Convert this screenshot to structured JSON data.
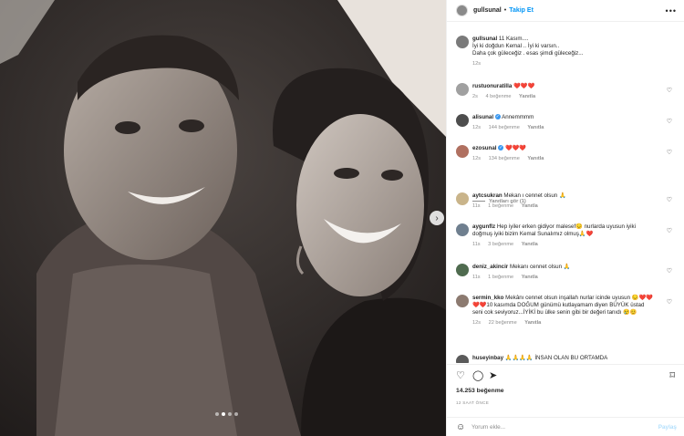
{
  "header": {
    "username": "gullsunal",
    "separator": "•",
    "follow_label": "Takip Et",
    "more_icon": "more-icon"
  },
  "caption": {
    "username": "gullsunal",
    "lines": [
      "11 Kasım....",
      "İyi ki doğdun Kemal .. İyi ki varsın..",
      "Daha çok güleceğiz . esas şimdi güleceğiz..."
    ],
    "time": "12s"
  },
  "comments": [
    {
      "username": "rustuonuratilla",
      "text": "❤️❤️❤️",
      "time": "2s",
      "likes": "4 beğenme",
      "reply": "Yanıtla",
      "verified": false
    },
    {
      "username": "alisunal",
      "text": "Annemmmm",
      "time": "12s",
      "likes": "144 beğenme",
      "reply": "Yanıtla",
      "verified": true
    },
    {
      "username": "ezosunal",
      "text": "❤️❤️❤️",
      "time": "12s",
      "likes": "134 beğenme",
      "reply": "Yanıtla",
      "verified": true
    },
    {
      "username": "aytcsukran",
      "text": "Mekan ı cennet olsun 🙏",
      "time": "11s",
      "likes": "1 beğenme",
      "reply": "Yanıtla",
      "verified": false
    },
    {
      "username": "aygunflz",
      "text": "Hep iyiler erken gidiyor malesef😔 nurlarda uyusun iyiki doğmuş iyiki bizim Kemal Sunalımız olmuş🙏❤️",
      "time": "11s",
      "likes": "3 beğenme",
      "reply": "Yanıtla",
      "verified": false
    },
    {
      "username": "deniz_akincir",
      "text": "Mekanı cennet olsun 🙏",
      "time": "11s",
      "likes": "1 beğenme",
      "reply": "Yanıtla",
      "verified": false
    },
    {
      "username": "sermin_kko",
      "text": "Mekânı cennet olsun inşallah nurlar icinde uyusun 😔❤️❤️❤️❤️10 kasımda DOĞUM günümü kutlayamam diyen BÜYÜK üstad seni cok seviyoruz...İYİKİ bu ülke senin gibi bir değeri tanıdı 😢😊",
      "time": "12s",
      "likes": "22 beğenme",
      "reply": "Yanıtla",
      "verified": false
    },
    {
      "username": "huseyinbay",
      "text": "🙏🙏🙏🙏 İNSAN OLAN BU ORTAMDA",
      "time": "",
      "likes": "",
      "reply": "",
      "verified": false
    }
  ],
  "view_replies": "Yanıtları gör (1)",
  "actions": {
    "like_icon": "heart-icon",
    "comment_icon": "comment-icon",
    "share_icon": "share-icon",
    "save_icon": "bookmark-icon"
  },
  "likes_count": "14.253 beğenme",
  "posted_time": "12 SAAT ÖNCE",
  "add_comment": {
    "placeholder": "Yorum ekle...",
    "post_label": "Paylaş",
    "emoji_icon": "smiley-icon"
  },
  "carousel": {
    "next_icon": "chevron-right-icon",
    "dots": 4,
    "active_dot": 1
  },
  "colors": {
    "link_blue": "#0095f6",
    "verified_blue": "#3897f0",
    "heart_red": "#ed4956",
    "muted": "#8e8e8e",
    "border": "#efefef"
  }
}
